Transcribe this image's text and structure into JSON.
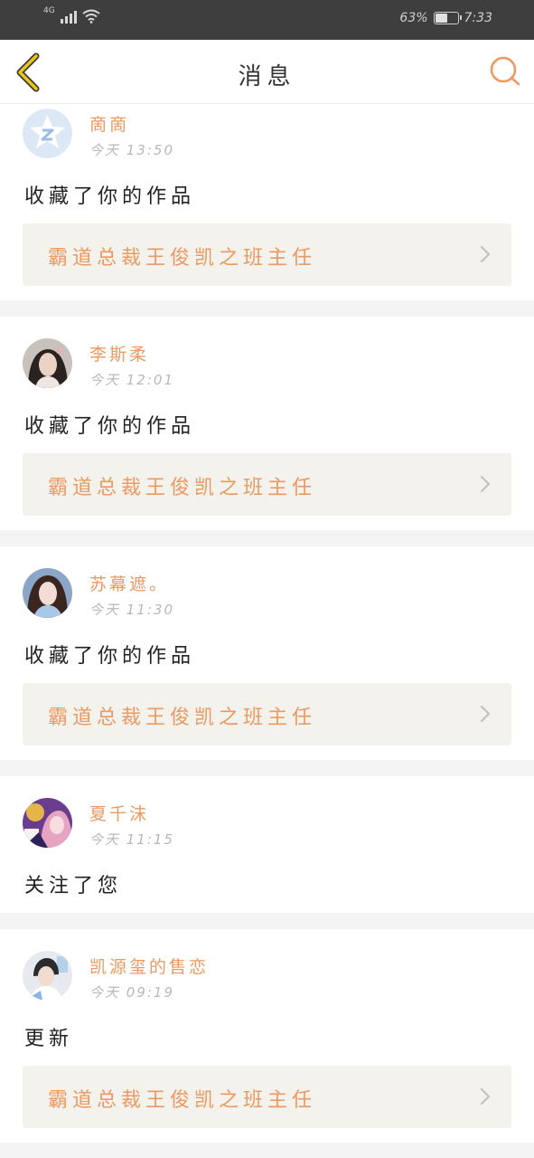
{
  "status_bar": {
    "network": "4G",
    "battery_percent": "63%",
    "battery_level": 0.63,
    "time": "7:33"
  },
  "header": {
    "title": "消息"
  },
  "colors": {
    "accent": "#EA9A62",
    "back_icon": "#E8C51C",
    "work_bg": "#F3F2EC"
  },
  "icons": {
    "back": "chevron-left-icon",
    "search": "search-icon",
    "work_arrow": "chevron-right-icon"
  },
  "messages": [
    {
      "name": "啇啇",
      "time": "今天 13:50",
      "action": "收藏了你的作品",
      "work_title": "霸道总裁王俊凯之班主任"
    },
    {
      "name": "李斯柔",
      "time": "今天 12:01",
      "action": "收藏了你的作品",
      "work_title": "霸道总裁王俊凯之班主任"
    },
    {
      "name": "苏幕遮。",
      "time": "今天 11:30",
      "action": "收藏了你的作品",
      "work_title": "霸道总裁王俊凯之班主任"
    },
    {
      "name": "夏千沫",
      "time": "今天 11:15",
      "action": "关注了您"
    },
    {
      "name": "凯源玺的售恋",
      "time": "今天 09:19",
      "action": "更新",
      "work_title": "霸道总裁王俊凯之班主任"
    }
  ]
}
